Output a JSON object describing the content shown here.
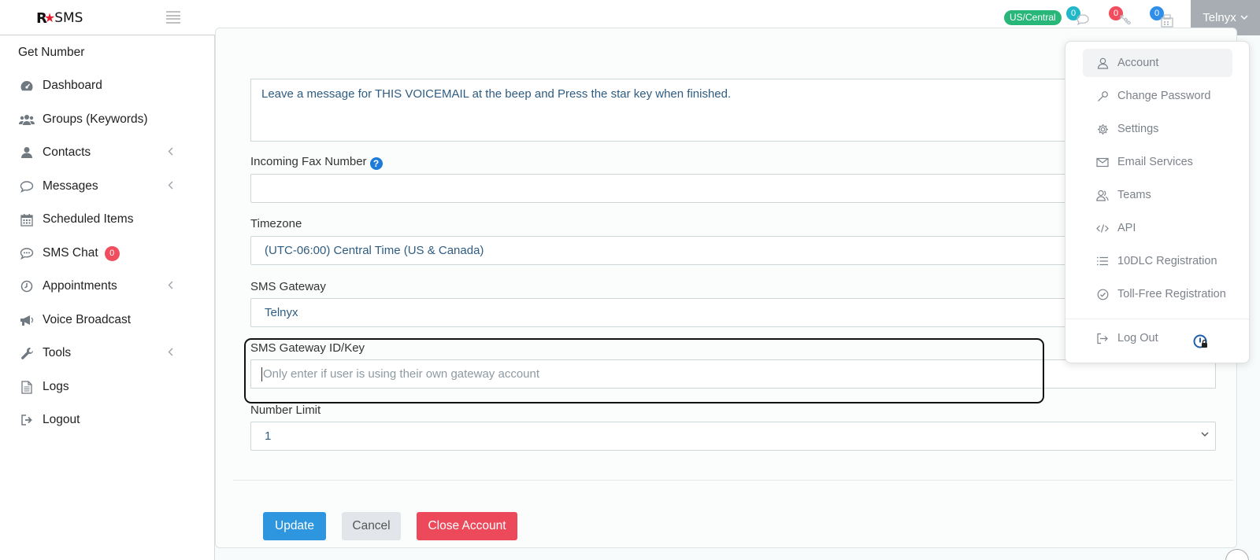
{
  "header": {
    "logo_r": "R",
    "logo_text": "SMS",
    "timezone_badge": "US/Central",
    "notifications": [
      {
        "count": "0",
        "color": "#22b8c9",
        "icon": "chat-icon"
      },
      {
        "count": "0",
        "color": "#f04e5e",
        "icon": "missed-call-icon"
      },
      {
        "count": "0",
        "color": "#2e8ee8",
        "icon": "fax-icon"
      }
    ],
    "user_label": "Telnyx"
  },
  "sidebar": {
    "get_number": "Get Number",
    "items": [
      {
        "label": "Dashboard",
        "icon": "dashboard-icon",
        "chevron": false
      },
      {
        "label": "Groups (Keywords)",
        "icon": "users-icon",
        "chevron": false
      },
      {
        "label": "Contacts",
        "icon": "user-icon",
        "chevron": true
      },
      {
        "label": "Messages",
        "icon": "comment-icon",
        "chevron": true
      },
      {
        "label": "Scheduled Items",
        "icon": "calendar-icon",
        "chevron": false
      },
      {
        "label": "SMS Chat",
        "icon": "sms-chat-icon",
        "chevron": false,
        "badge": "0"
      },
      {
        "label": "Appointments",
        "icon": "clock-icon",
        "chevron": true
      },
      {
        "label": "Voice Broadcast",
        "icon": "bullhorn-icon",
        "chevron": false
      },
      {
        "label": "Tools",
        "icon": "wrench-icon",
        "chevron": true
      },
      {
        "label": "Logs",
        "icon": "document-icon",
        "chevron": false
      },
      {
        "label": "Logout",
        "icon": "logout-icon",
        "chevron": false
      }
    ]
  },
  "form": {
    "voicemail_message": "Leave a message for THIS VOICEMAIL at the beep and Press the star key when finished.",
    "fax_label": "Incoming Fax Number",
    "fax_value": "",
    "timezone_label": "Timezone",
    "timezone_value": "(UTC-06:00) Central Time (US & Canada)",
    "gateway_label": "SMS Gateway",
    "gateway_value": "Telnyx",
    "gateway_key_label": "SMS Gateway ID/Key",
    "gateway_key_placeholder": "Only enter if user is using their own gateway account",
    "number_limit_label": "Number Limit",
    "number_limit_value": "1",
    "update_label": "Update",
    "cancel_label": "Cancel",
    "close_account_label": "Close Account"
  },
  "dropdown": {
    "items": [
      {
        "label": "Account",
        "icon": "user-outline-icon",
        "active": true
      },
      {
        "label": "Change Password",
        "icon": "key-icon",
        "active": false
      },
      {
        "label": "Settings",
        "icon": "gear-icon",
        "active": false
      },
      {
        "label": "Email Services",
        "icon": "envelope-icon",
        "active": false
      },
      {
        "label": "Teams",
        "icon": "team-icon",
        "active": false
      },
      {
        "label": "API",
        "icon": "code-icon",
        "active": false
      },
      {
        "label": "10DLC Registration",
        "icon": "list-icon",
        "active": false
      },
      {
        "label": "Toll-Free Registration",
        "icon": "check-circle-icon",
        "active": false
      }
    ],
    "logout_label": "Log Out"
  }
}
